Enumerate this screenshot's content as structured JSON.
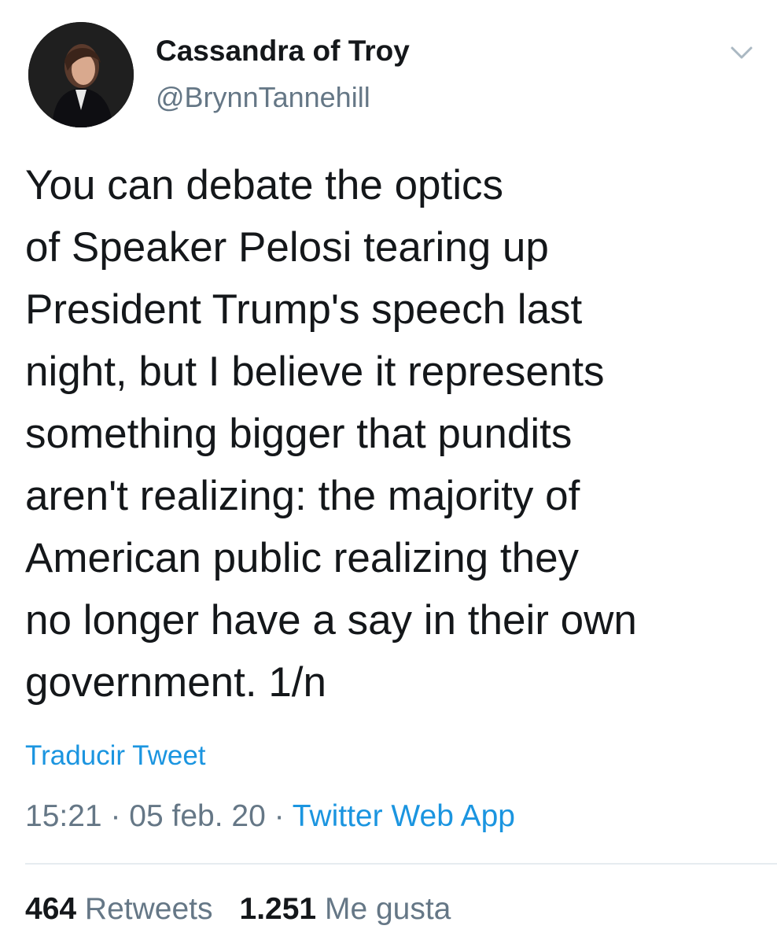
{
  "user": {
    "display_name": "Cassandra of Troy",
    "handle": "@BrynnTannehill"
  },
  "icons": {
    "avatar": "profile-photo",
    "menu": "chevron-down-icon"
  },
  "tweet": {
    "text": "You can debate the optics\nof Speaker Pelosi tearing up\nPresident Trump's speech last\nnight, but I believe it represents\nsomething bigger that pundits\naren't realizing: the majority of\nAmerican public realizing they\nno longer have a say in their own\ngovernment. 1/n",
    "translate_label": "Traducir Tweet",
    "time": "15:21",
    "separator1": " · ",
    "date": "05 feb. 20",
    "separator2": " · ",
    "source": "Twitter Web App"
  },
  "stats": {
    "retweets_count": "464",
    "retweets_label": "Retweets",
    "likes_count": "1.251",
    "likes_label": "Me gusta"
  },
  "colors": {
    "link": "#1b95e0",
    "secondary_text": "#657786",
    "primary_text": "#14171a",
    "divider": "#e6ecf0"
  }
}
